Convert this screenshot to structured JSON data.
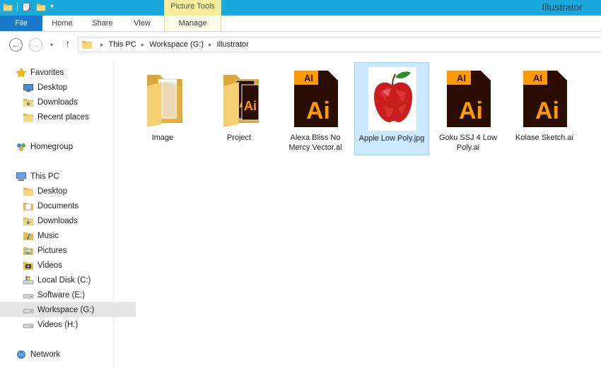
{
  "window": {
    "title": "Illustrator",
    "context_group": "Picture Tools"
  },
  "qat": {
    "icons": [
      "folder-icon",
      "properties-icon",
      "new-folder-icon"
    ],
    "dropdown_glyph": "▾"
  },
  "ribbon": {
    "tabs": [
      {
        "label": "File",
        "active": true
      },
      {
        "label": "Home"
      },
      {
        "label": "Share"
      },
      {
        "label": "View"
      },
      {
        "label": "Manage"
      }
    ]
  },
  "nav": {
    "back_glyph": "←",
    "forward_glyph": "→",
    "recent_glyph": "▾",
    "up_glyph": "↑"
  },
  "address": {
    "separator": "▸",
    "crumbs": [
      "This PC",
      "Workspace (G:)",
      "Illustrator"
    ]
  },
  "sidebar": {
    "favorites": {
      "label": "Favorites",
      "items": [
        "Desktop",
        "Downloads",
        "Recent places"
      ]
    },
    "homegroup": {
      "label": "Homegroup"
    },
    "this_pc": {
      "label": "This PC",
      "items": [
        "Desktop",
        "Documents",
        "Downloads",
        "Music",
        "Pictures",
        "Videos",
        "Local Disk (C:)",
        "Software (E:)",
        "Workspace (G:)",
        "Videos (H:)"
      ],
      "selected": "Workspace (G:)"
    },
    "network": {
      "label": "Network"
    }
  },
  "files": [
    {
      "name": "Image",
      "type": "folder"
    },
    {
      "name": "Project",
      "type": "folder-with-files"
    },
    {
      "name": "Alexa Bliss No Mercy Vector.ai",
      "type": "ai",
      "badge": "AI",
      "glyph": "Ai"
    },
    {
      "name": "Apple Low Poly.jpg",
      "type": "image",
      "selected": true
    },
    {
      "name": "Goku SSJ 4 Low Poly.ai",
      "type": "ai",
      "badge": "AI",
      "glyph": "Ai"
    },
    {
      "name": "Kolase Sketch.ai",
      "type": "ai",
      "badge": "AI",
      "glyph": "Ai"
    }
  ],
  "colors": {
    "titlebar": "#19a9db",
    "file_tab": "#1979ca",
    "picture_tools": "#f7ed9a",
    "selection": "#cce8ff",
    "ai_orange": "#ff9a00",
    "ai_dark": "#2b0e02"
  }
}
